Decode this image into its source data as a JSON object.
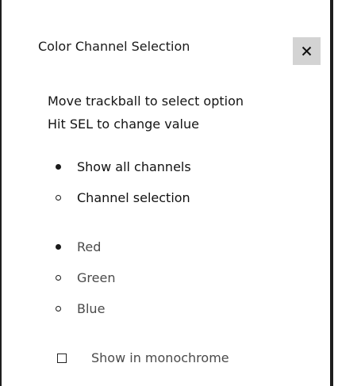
{
  "dialog": {
    "title": "Color Channel Selection",
    "close_label": "Close"
  },
  "instructions": {
    "line1": "Move trackball to select option",
    "line2": "Hit SEL to change value"
  },
  "display_mode": {
    "options": [
      {
        "label": "Show all channels",
        "selected": true
      },
      {
        "label": "Channel selection",
        "selected": false
      }
    ]
  },
  "channels": {
    "options": [
      {
        "label": "Red",
        "selected": true
      },
      {
        "label": "Green",
        "selected": false
      },
      {
        "label": "Blue",
        "selected": false
      }
    ]
  },
  "monochrome": {
    "label": "Show in monochrome",
    "checked": false
  },
  "colors": {
    "close_button_bg": "#d3d3d3",
    "disabled_text": "#4a4a4a",
    "text": "#111111"
  }
}
